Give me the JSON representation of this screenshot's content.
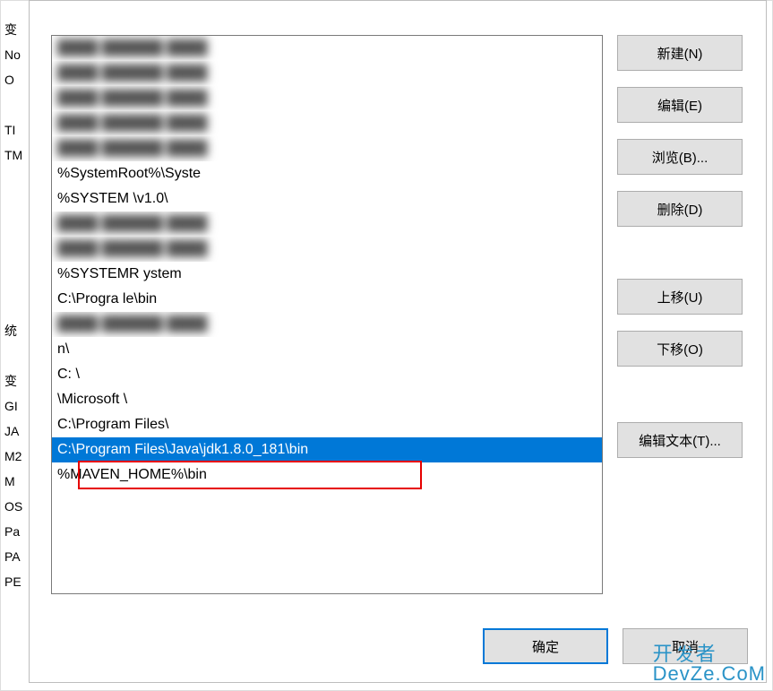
{
  "background": {
    "left_labels": [
      "变",
      "No",
      "O",
      "",
      "TI",
      "TM",
      "",
      "",
      "",
      "",
      "",
      "",
      "统",
      "",
      "变",
      "GI",
      "JA",
      "M2",
      "M",
      "OS",
      "Pa",
      "PA",
      "PE"
    ]
  },
  "list": {
    "items": [
      {
        "text": " ",
        "blur": true
      },
      {
        "text": " ",
        "blur": true
      },
      {
        "text": " ",
        "blur": true
      },
      {
        "text": " ",
        "blur": true
      },
      {
        "text": " ",
        "blur": true
      },
      {
        "text": "%SystemRoot%\\Syste",
        "blur_partial": true
      },
      {
        "text": "%SYSTEM                                          \\v1.0\\",
        "blur_partial": true
      },
      {
        "text": " ",
        "blur": true
      },
      {
        "text": " ",
        "blur": true
      },
      {
        "text": "%SYSTEMR          ystem",
        "blur_partial": true
      },
      {
        "text": "C:\\Progra                           le\\bin",
        "blur_partial": true
      },
      {
        "text": " ",
        "blur": true
      },
      {
        "text": "                                       n\\",
        "blur_partial": true
      },
      {
        "text": "C:                                                              \\",
        "blur_partial": true
      },
      {
        "text": "                    \\Microsoft                               \\",
        "blur_partial": true
      },
      {
        "text": "C:\\Program Files\\",
        "blur_partial": true
      },
      {
        "text": "C:\\Program Files\\Java\\jdk1.8.0_181\\bin",
        "selected": true,
        "highlighted": true
      },
      {
        "text": "%MAVEN_HOME%\\bin"
      }
    ]
  },
  "buttons": {
    "new": "新建(N)",
    "edit": "编辑(E)",
    "browse": "浏览(B)...",
    "delete": "删除(D)",
    "moveup": "上移(U)",
    "movedown": "下移(O)",
    "edittext": "编辑文本(T)...",
    "ok": "确定",
    "cancel": "取消"
  },
  "watermark": {
    "line1_prefix": "开",
    "line1_mid": "发",
    "line1_suffix": "者",
    "line2": "DevZe.CoM"
  }
}
